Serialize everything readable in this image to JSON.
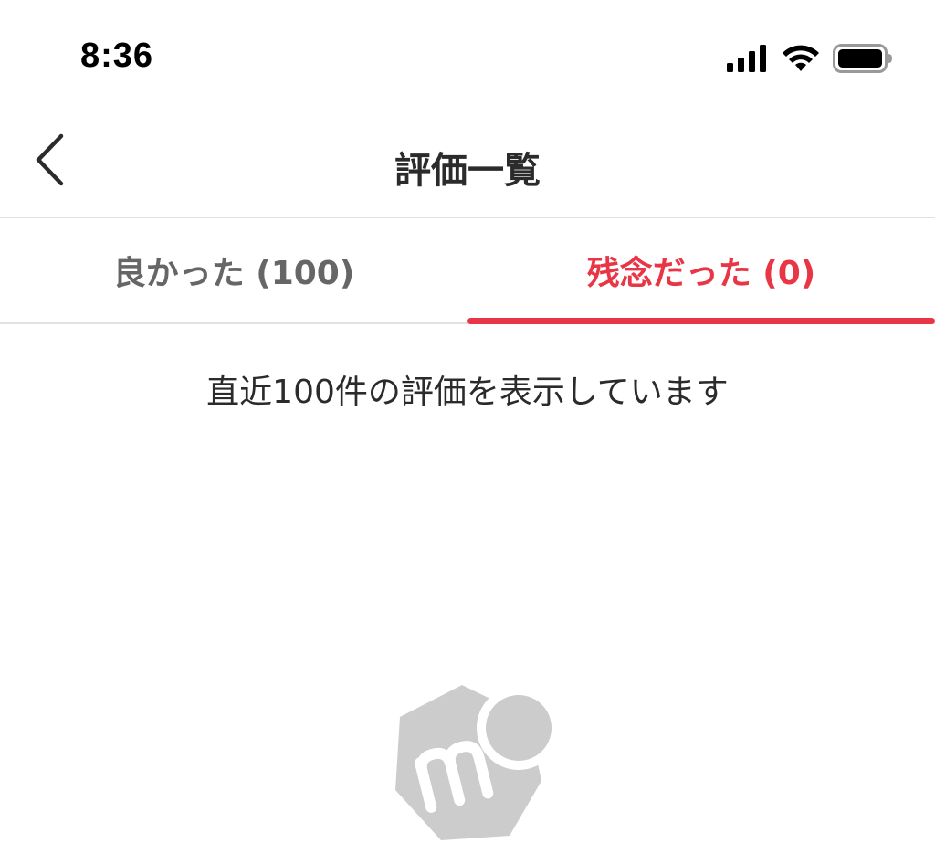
{
  "status_bar": {
    "time": "8:36",
    "icons": [
      "signal-icon",
      "wifi-icon",
      "battery-icon"
    ]
  },
  "header": {
    "back_icon": "chevron-left-icon",
    "title": "評価一覧"
  },
  "tabs": [
    {
      "label": "良かった (100)",
      "selected": false
    },
    {
      "label": "残念だった (0)",
      "selected": true
    }
  ],
  "main": {
    "notice": "直近100件の評価を表示しています",
    "empty_logo_icon": "mercari-logo-icon"
  },
  "colors": {
    "accent": "#e83646",
    "tab_inactive": "#666666",
    "logo_gray": "#cccccc"
  }
}
